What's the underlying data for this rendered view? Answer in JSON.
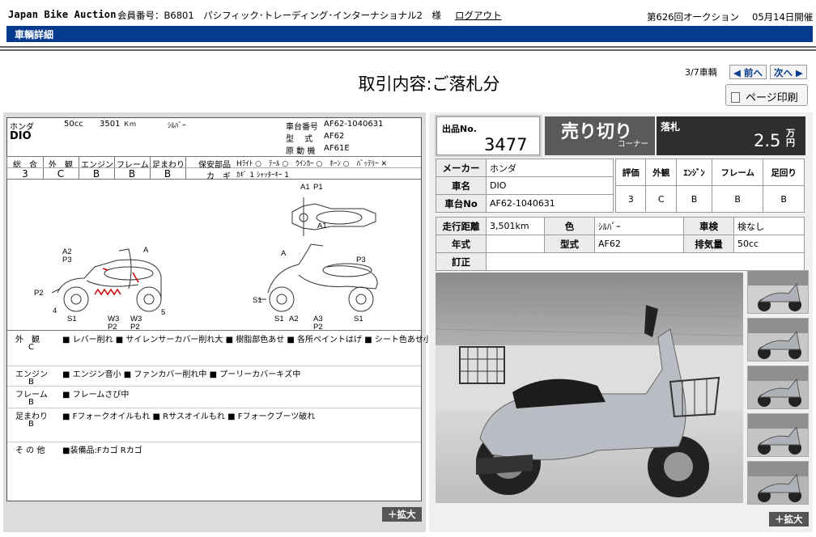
{
  "header": {
    "brand": "Japan Bike Auction",
    "member": "会員番号：B6801　パシフィック･トレーディング･インターナショナル2　様",
    "logout": "ログアウト",
    "auction": "第626回オークション",
    "date": "05月14日開催"
  },
  "bar": {
    "label": "車輌詳細"
  },
  "page": {
    "title": "取引内容:ご落札分",
    "vehicle_count": "3/7車輌",
    "prev_label": "◀ 前へ",
    "next_label": "次へ ▶",
    "print_label": "ページ印刷",
    "zoom_label": "＋拡大"
  },
  "sheet": {
    "maker": "ホンダ",
    "cc": "50cc",
    "km": "3501",
    "km_unit": "Ｋｍ",
    "color": "ｼﾙﾊﾞｰ",
    "model": "DIO",
    "frame_label": "車台番号",
    "frame_value": "AF62-1040631",
    "type_label": "型　 式",
    "type_value": "AF62",
    "engine_label": "原 動 機",
    "engine_value": "AF61E",
    "grade_headers": [
      "総　合",
      "外　観",
      "エンジン",
      "フレーム",
      "足まわり"
    ],
    "grade_values": [
      "3",
      "C",
      "B",
      "B",
      "B"
    ],
    "safety_label": "保安部品",
    "safety_items": "Hﾗｲﾄ ○　ﾃｰﾙ ○　ｳｲﾝｶｰ ○　ﾎｰﾝ ○　ﾊﾞｯﾃﾘｰ ✕",
    "key_label": "カ　ギ",
    "key_value": "ｶｷﾞ 1 ｼｬｯﾀｰｷｰ 1",
    "diagram_labels": {
      "a1": "A1",
      "p1": "P1",
      "a1b": "A1",
      "a2": "A2",
      "p3": "P3",
      "a": "A",
      "p2": "P2",
      "four": "4",
      "s1": "S1",
      "w3": "W3",
      "p2b": "P2",
      "w3b": "W3",
      "p2c": "P2",
      "five": "5",
      "a_r": "A",
      "p3_r": "P3",
      "s1_r": "S1",
      "s1_r2": "S1",
      "a2_r": "A2",
      "a3_r": "A3",
      "p2_r": "P2",
      "s1_r3": "S1"
    },
    "notes": [
      {
        "cat": "外　観",
        "grade": "C",
        "text": "■ レバー削れ ■ サイレンサーカバー削れ大 ■ 樹脂部色あせ ■ 各所ペイントはげ ■ シート色あせ小"
      },
      {
        "cat": "エンジン",
        "grade": "B",
        "text": "■ エンジン音小 ■ ファンカバー削れ中 ■ プーリーカバーキズ中"
      },
      {
        "cat": "フレーム",
        "grade": "B",
        "text": "■ フレームさび中"
      },
      {
        "cat": "足まわり",
        "grade": "B",
        "text": "■ Fフォークオイルもれ ■ Rサスオイルもれ ■ Fフォークブーツ破れ"
      },
      {
        "cat": "そ の 他",
        "grade": "",
        "text": "■装備品:Fカゴ Rカゴ"
      }
    ]
  },
  "lot": {
    "label": "出品No.",
    "number": "3477"
  },
  "sale": {
    "label": "売り切り",
    "corner": "コーナー"
  },
  "price": {
    "label": "落札",
    "value": "2.5",
    "unit1": "万",
    "unit2": "円"
  },
  "spec1": {
    "maker_label": "メーカー",
    "maker": "ホンダ",
    "name_label": "車名",
    "name": "DIO",
    "frame_label": "車台No",
    "frame": "AF62-1040631",
    "grade_headers": [
      "評価",
      "外観",
      "ｴﾝｼﾞﾝ",
      "フレーム",
      "足回り"
    ],
    "grade_values": [
      "3",
      "C",
      "B",
      "B",
      "B"
    ]
  },
  "spec2": {
    "mileage_label": "走行距離",
    "mileage": "3,501km",
    "color_label": "色",
    "color": "ｼﾙﾊﾞｰ",
    "inspection_label": "車検",
    "inspection": "検なし",
    "year_label": "年式",
    "year": "",
    "model_label": "型式",
    "model": "AF62",
    "disp_label": "排気量",
    "disp": "50cc",
    "correction_label": "訂正",
    "correction": ""
  }
}
